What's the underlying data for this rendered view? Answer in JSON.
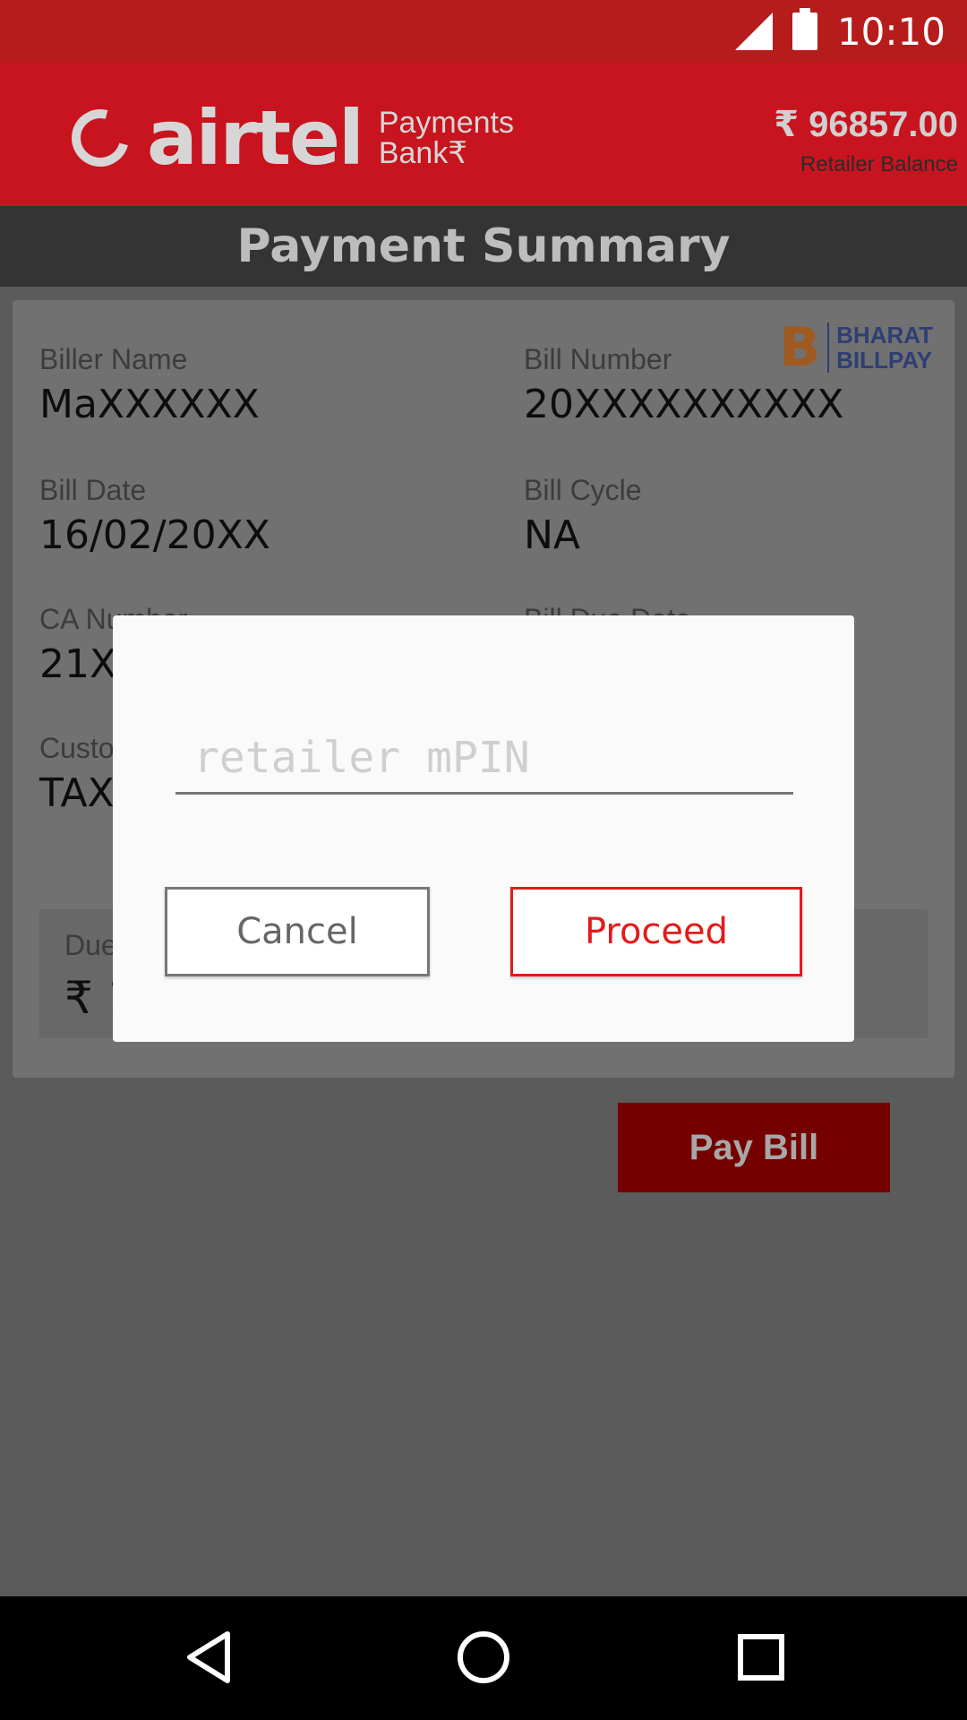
{
  "status_bar": {
    "time": "10:10"
  },
  "header": {
    "brand": "airtel",
    "brand_sub_line1": "Payments",
    "brand_sub_line2": "Bank₹",
    "balance_amount": "₹ 96857.00",
    "balance_label": "Retailer Balance"
  },
  "title": "Payment Summary",
  "bbps_logo": {
    "letter": "B",
    "line1": "BHARAT",
    "line2": "BILLPAY"
  },
  "fields": {
    "biller_name": {
      "label": "Biller Name",
      "value": "MaXXXXXX"
    },
    "bill_number": {
      "label": "Bill Number",
      "value": "20XXXXXXXXXX"
    },
    "bill_date": {
      "label": "Bill Date",
      "value": "16/02/20XX"
    },
    "bill_cycle": {
      "label": "Bill Cycle",
      "value": "NA"
    },
    "ca_number": {
      "label": "CA Number",
      "value": "21X"
    },
    "bill_due_date": {
      "label": "Bill Due Date",
      "value": ""
    },
    "customer": {
      "label": "Custo",
      "value": "TAX"
    }
  },
  "due": {
    "label": "Due",
    "value": "₹ 1"
  },
  "pay_bill_label": "Pay Bill",
  "dialog": {
    "mpin_placeholder": "retailer mPIN",
    "cancel_label": "Cancel",
    "proceed_label": "Proceed"
  },
  "colors": {
    "brand_red": "#c8141e",
    "proceed_red": "#e21b1b",
    "pay_bill": "#750000"
  }
}
